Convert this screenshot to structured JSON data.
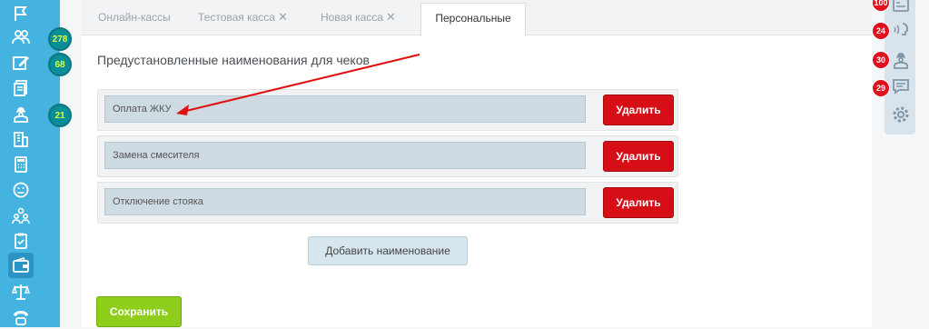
{
  "sidebar": {
    "items": [
      {
        "icon": "flag-icon"
      },
      {
        "icon": "clients-icon",
        "badge": "278"
      },
      {
        "icon": "edit-note-icon",
        "badge": "68"
      },
      {
        "icon": "documents-icon"
      },
      {
        "icon": "worker-icon",
        "badge": "21"
      },
      {
        "icon": "building-icon"
      },
      {
        "icon": "calculator-icon"
      },
      {
        "icon": "smiley-icon"
      },
      {
        "icon": "team-icon"
      },
      {
        "icon": "checklist-icon"
      },
      {
        "icon": "wallet-icon",
        "active": true
      },
      {
        "icon": "scales-icon"
      },
      {
        "icon": "phone-icon"
      }
    ]
  },
  "tabs": [
    {
      "label": "Онлайн-кассы"
    },
    {
      "label": "Тестовая касса",
      "close": "✕"
    },
    {
      "label": "Новая касса",
      "close": "✕"
    },
    {
      "label": "Персональные",
      "active": true
    }
  ],
  "main": {
    "section_title": "Предустановленные наименования для чеков",
    "rows": [
      {
        "value": "Оплата ЖКУ",
        "delete_label": "Удалить"
      },
      {
        "value": "Замена смесителя",
        "delete_label": "Удалить"
      },
      {
        "value": "Отключение стояка",
        "delete_label": "Удалить"
      }
    ],
    "add_label": "Добавить наименование",
    "save_label": "Сохранить"
  },
  "right_panel": {
    "items": [
      {
        "icon": "id-card-icon",
        "badge": "100"
      },
      {
        "icon": "voice-icon",
        "badge": "24"
      },
      {
        "icon": "worker-icon",
        "badge": "30"
      },
      {
        "icon": "chat-icon",
        "badge": "29"
      },
      {
        "icon": "gear-icon"
      }
    ]
  },
  "colors": {
    "sidebar": "#45b3e0",
    "delete": "#d60f17",
    "save": "#8fce1c",
    "annotation_arrow": "#e01010"
  }
}
